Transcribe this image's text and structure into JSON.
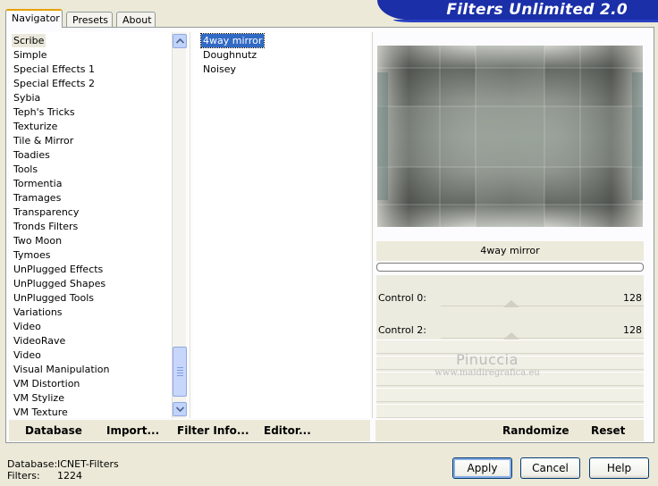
{
  "tabs": [
    {
      "label": "Navigator",
      "active": true
    },
    {
      "label": "Presets",
      "active": false
    },
    {
      "label": "About",
      "active": false
    }
  ],
  "banner": {
    "title": "Filters Unlimited 2.0"
  },
  "categories": {
    "selected": "Scribe",
    "items": [
      "Scribe",
      "Simple",
      "Special Effects 1",
      "Special Effects 2",
      "Sybia",
      "Teph's Tricks",
      "Texturize",
      "Tile & Mirror",
      "Toadies",
      "Tools",
      "Tormentia",
      "Tramages",
      "Transparency",
      "Tronds Filters",
      "Two Moon",
      "Tymoes",
      "UnPlugged Effects",
      "UnPlugged Shapes",
      "UnPlugged Tools",
      "Variations",
      "Video",
      "VideoRave",
      "Video",
      "Visual Manipulation",
      "VM Distortion",
      "VM Stylize",
      "VM Texture"
    ]
  },
  "filters": {
    "selected": "4way mirror",
    "items": [
      "4way mirror",
      "Doughnutz",
      "Noisey"
    ]
  },
  "preview": {
    "filter_name": "4way mirror",
    "progress": 0
  },
  "controls": [
    {
      "label": "Control 0:",
      "value": "128",
      "level": 0.5
    },
    {
      "label": "Control 2:",
      "value": "128",
      "level": 0.5
    }
  ],
  "watermark": {
    "title": "Pinuccia",
    "url": "www.maidiregrafica.eu"
  },
  "left_buttons": {
    "database": "Database",
    "import": "Import...",
    "filter_info": "Filter Info...",
    "editor": "Editor..."
  },
  "right_buttons": {
    "randomize": "Randomize",
    "reset": "Reset"
  },
  "status": {
    "database_label": "Database:",
    "database_value": "ICNET-Filters",
    "filters_label": "Filters:",
    "filters_value": "1224"
  },
  "dialog_buttons": {
    "apply": "Apply",
    "cancel": "Cancel",
    "help": "Help"
  },
  "colors": {
    "banner": "#1a2fa8",
    "selection": "#316ac5",
    "window_bg": "#ece9d8"
  }
}
